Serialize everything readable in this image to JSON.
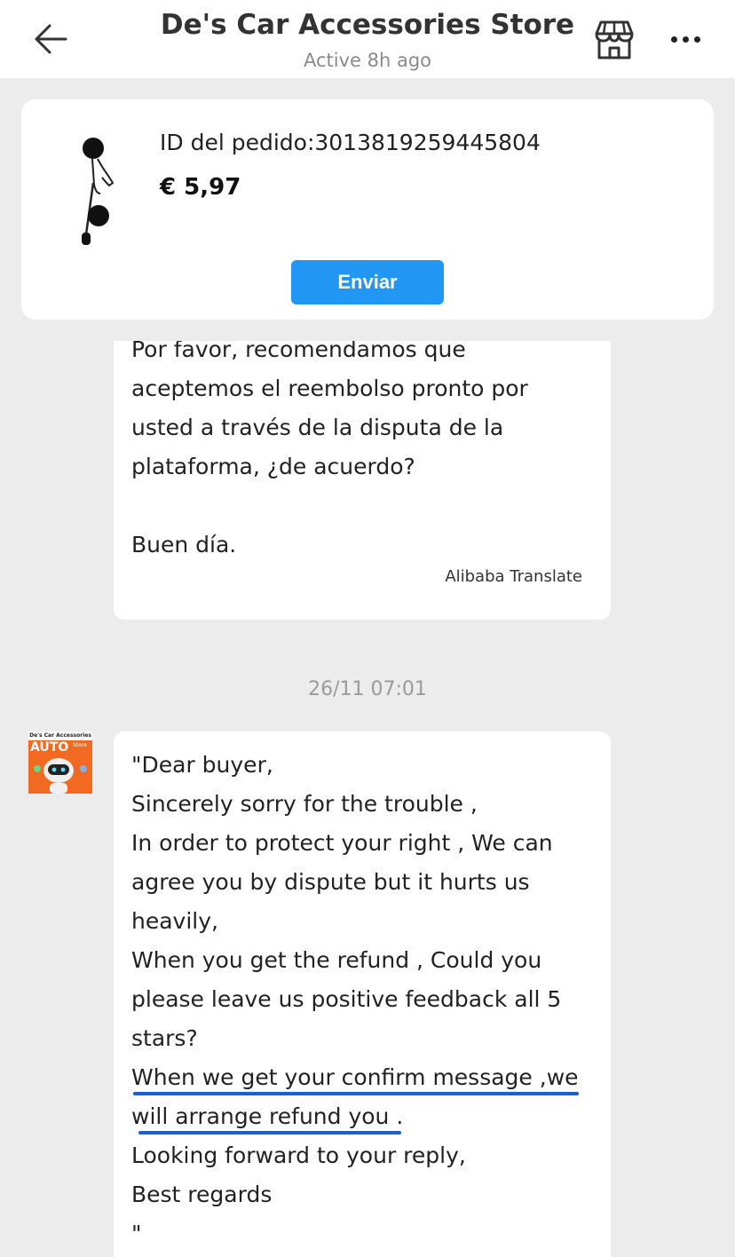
{
  "header": {
    "title": "De's Car Accessories Store",
    "status": "Active 8h ago",
    "icons": {
      "back": "arrow-left-icon",
      "store": "store-icon",
      "more": "more-horizontal-icon"
    }
  },
  "order": {
    "id_label": "ID del pedido:3013819259445804",
    "price": "€ 5,97",
    "send_label": "Enviar"
  },
  "messages": {
    "first": {
      "lines": [
        "Por favor, recomendamos que",
        "aceptemos el reembolso pronto por",
        "usted a través de la disputa de la",
        "plataforma, ¿de acuerdo?",
        "",
        "Buen día."
      ],
      "translate_tag": "Alibaba Translate"
    },
    "timestamp": "26/11 07:01",
    "avatar": {
      "store_name": "De's Car Accessories",
      "brand": "AUTO",
      "store_label": "Store"
    },
    "second": {
      "lines": [
        "\"Dear buyer,",
        "Sincerely sorry for the trouble ,",
        "In order to protect your right , We can",
        "agree you by dispute but it hurts us",
        "heavily,",
        "When you get the refund , Could you",
        "please leave us positive feedback all 5",
        "stars?",
        "When we get your confirm message ,we",
        "will arrange refund you .",
        "Looking forward to your reply,",
        "Best regards",
        "\""
      ]
    }
  },
  "colors": {
    "accent": "#2196f3",
    "underline": "#1d5fd0",
    "avatar_bg": "#f26a21"
  }
}
